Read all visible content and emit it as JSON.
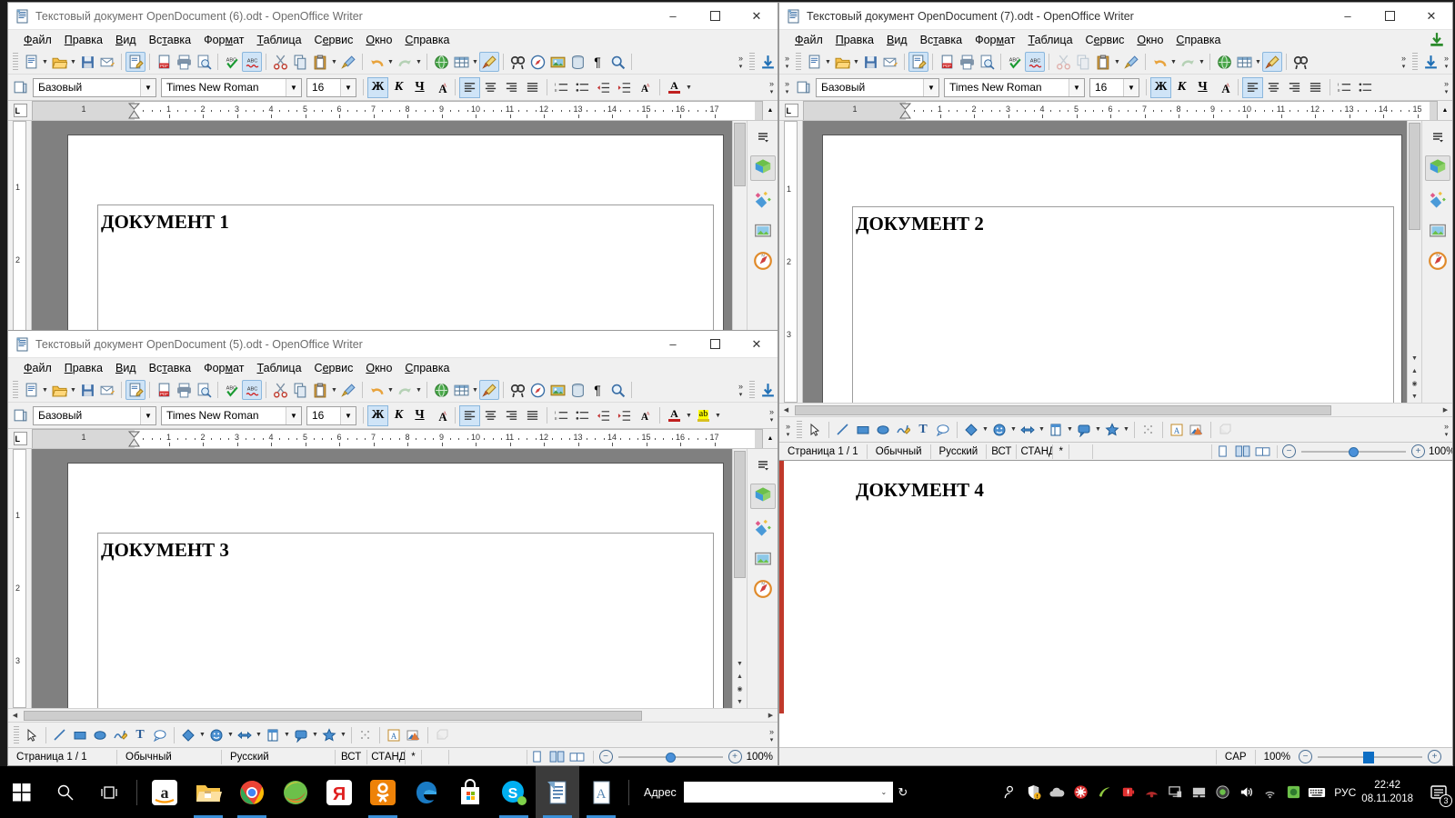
{
  "desktop": {
    "background_color": "#1b1b1b"
  },
  "menu_items": [
    {
      "label": "Файл",
      "accel": "Ф"
    },
    {
      "label": "Правка",
      "accel": "П"
    },
    {
      "label": "Вид",
      "accel": "В"
    },
    {
      "label": "Вставка",
      "accel": "т"
    },
    {
      "label": "Формат",
      "accel": "Ф"
    },
    {
      "label": "Таблица",
      "accel": "Т"
    },
    {
      "label": "Сервис",
      "accel": "е"
    },
    {
      "label": "Окно",
      "accel": "О"
    },
    {
      "label": "Справка",
      "accel": "С"
    }
  ],
  "format_bar": {
    "style_value": "Базовый",
    "font_value": "Times New Roman",
    "size_value": "16",
    "bold_label": "Ж",
    "italic_label": "К",
    "underline_label": "Ч",
    "strike_label": "A",
    "font_color_label": "A",
    "highlight_label": "ab"
  },
  "ruler": {
    "numbers": [
      "1",
      "1",
      "2",
      "3",
      "4",
      "5",
      "6",
      "7",
      "8",
      "9",
      "10",
      "11",
      "12",
      "13",
      "14",
      "15",
      "16",
      "17"
    ]
  },
  "status_bar": {
    "page": "Страница  1 / 1",
    "style": "Обычный",
    "language": "Русский",
    "insert_mode": "ВСТ",
    "selection_mode": "СТАНД",
    "modified": "*",
    "zoom": "100%"
  },
  "windows": [
    {
      "id": "win1",
      "title": "Текстовый документ OpenDocument (6).odt - OpenOffice Writer",
      "active": false,
      "doc_text": "ДОКУМЕНТ 1"
    },
    {
      "id": "win2",
      "title": "Текстовый документ OpenDocument (7).odt - OpenOffice Writer",
      "active": true,
      "doc_text": "ДОКУМЕНТ 2"
    },
    {
      "id": "win3",
      "title": "Текстовый документ OpenDocument (5).odt - OpenOffice Writer",
      "active": false,
      "doc_text": "ДОКУМЕНТ 3"
    },
    {
      "id": "win4",
      "title": "",
      "active": false,
      "doc_text": "ДОКУМЕНТ  4"
    }
  ],
  "win4_status": {
    "caps": "CAP",
    "zoom": "100%"
  },
  "window_controls": {
    "minimize": "–",
    "maximize": "☐",
    "close": "✕"
  },
  "taskbar": {
    "address_label": "Адрес",
    "language": "РУС",
    "time": "22:42",
    "date": "08.11.2018",
    "notification_count": "3",
    "items": [
      {
        "name": "start-button",
        "icon": "windows-logo"
      },
      {
        "name": "search-button",
        "icon": "search-icon"
      },
      {
        "name": "task-view-button",
        "icon": "task-view-icon"
      },
      {
        "name": "amazon-app",
        "icon": "amazon-icon"
      },
      {
        "name": "file-explorer",
        "icon": "folder-icon"
      },
      {
        "name": "google-chrome",
        "icon": "chrome-icon"
      },
      {
        "name": "firefox-browser",
        "icon": "firefox-icon"
      },
      {
        "name": "yandex-browser",
        "icon": "yandex-icon"
      },
      {
        "name": "odnoklassniki",
        "icon": "ok-icon"
      },
      {
        "name": "microsoft-edge",
        "icon": "edge-icon"
      },
      {
        "name": "microsoft-store",
        "icon": "store-icon"
      },
      {
        "name": "skype",
        "icon": "skype-icon"
      },
      {
        "name": "openoffice-writer",
        "icon": "writer-icon"
      },
      {
        "name": "text-editor",
        "icon": "abbyy-icon"
      }
    ]
  }
}
